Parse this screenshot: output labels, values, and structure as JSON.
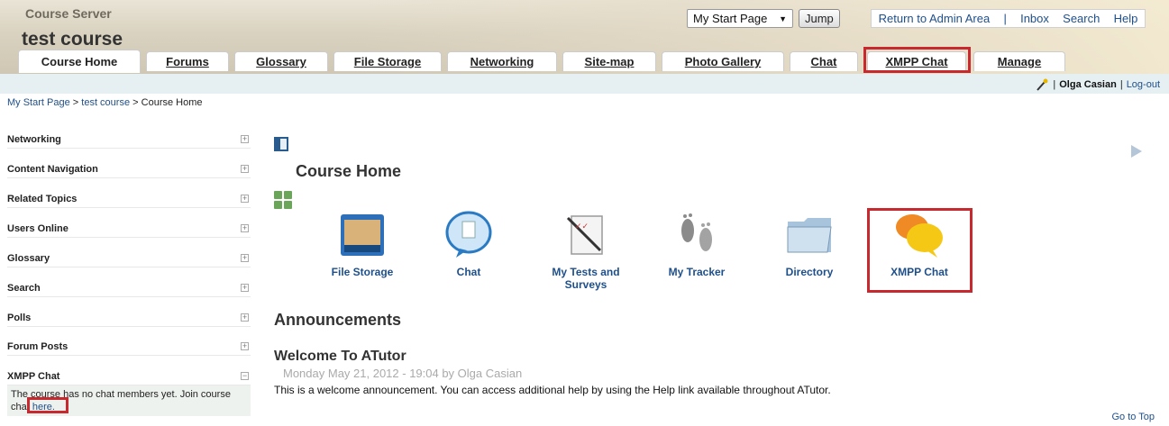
{
  "header": {
    "site_name": "Course Server",
    "course_title": "test course",
    "jump_select": "My Start Page",
    "jump_button": "Jump",
    "links": [
      "Return to Admin Area",
      "Inbox",
      "Search",
      "Help"
    ]
  },
  "tabs": [
    {
      "label": "Course Home",
      "active": true
    },
    {
      "label": "Forums"
    },
    {
      "label": "Glossary"
    },
    {
      "label": "File Storage"
    },
    {
      "label": "Networking"
    },
    {
      "label": "Site-map"
    },
    {
      "label": "Photo Gallery"
    },
    {
      "label": "Chat"
    },
    {
      "label": "XMPP Chat"
    },
    {
      "label": "Manage"
    }
  ],
  "user": {
    "name": "Olga Casian",
    "logout": "Log-out"
  },
  "breadcrumb": {
    "start": "My Start Page",
    "course": "test course",
    "current": "Course Home",
    "sep": ">"
  },
  "sidebar": {
    "items": [
      "Networking",
      "Content Navigation",
      "Related Topics",
      "Users Online",
      "Glossary",
      "Search",
      "Polls",
      "Forum Posts",
      "XMPP Chat"
    ],
    "chat_text": "The course has no chat members yet. Join course chat",
    "chat_link": "here."
  },
  "main": {
    "title": "Course Home",
    "tools": [
      {
        "label": "File Storage",
        "icon": "file-storage-icon"
      },
      {
        "label": "Chat",
        "icon": "chat-bubble-icon"
      },
      {
        "label": "My Tests and Surveys",
        "icon": "tests-icon"
      },
      {
        "label": "My Tracker",
        "icon": "footprints-icon"
      },
      {
        "label": "Directory",
        "icon": "directory-icon"
      },
      {
        "label": "XMPP Chat",
        "icon": "xmpp-chat-icon"
      }
    ],
    "announcements_title": "Announcements",
    "post_title": "Welcome To ATutor",
    "post_date": "Monday May 21, 2012 - 19:04 by Olga Casian",
    "post_body": "This is a welcome announcement. You can access additional help by using the Help link available throughout ATutor.",
    "goto_top": "Go to Top"
  },
  "colors": {
    "highlight": "#c8292f",
    "link": "#1f4f8a"
  }
}
